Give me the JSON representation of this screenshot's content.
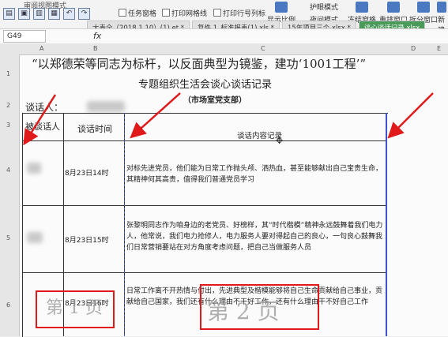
{
  "toolbar": {
    "menu_partial": "审阅视图模式",
    "checkbox_task_pane": "任务窗格",
    "checkbox_print_gridlines": "打印网格线",
    "checkbox_print_row_col": "打印行号列标",
    "btn_show_ratio": "显示比例",
    "btn_eye_protection": "护眼模式",
    "btn_night_mode": "夜间模式",
    "btn_freeze": "冻结窗格",
    "btn_rearrange": "重排窗口",
    "btn_split": "拆分窗口",
    "btn_new": "新建"
  },
  "tabs": [
    {
      "label": "大表全（2018.1.10）(1).et *"
    },
    {
      "label": "复件 1_标准报表(1).xls *"
    },
    {
      "label": "15年项目三个.xlsx *"
    },
    {
      "label": "谈心谈话记录.xlsx"
    }
  ],
  "formula_bar": {
    "cell_ref": "G49",
    "fx": "fx"
  },
  "columns": [
    "A",
    "B",
    "C",
    "D",
    "E"
  ],
  "rows": [
    "1",
    "2",
    "3",
    "4",
    "5",
    "6"
  ],
  "document": {
    "title_line1": "“以郑德荣等同志为标杆，以反面典型为镜鉴，建功‘1001工程’”",
    "title_line2": "专题组织生活会谈心谈话记录",
    "title_line3": "（市场室党支部）",
    "talker_label": "谈话人：",
    "headers": {
      "person": "被谈话人",
      "time": "谈话时间",
      "content": "谈话内容记录"
    },
    "records": [
      {
        "time": "8月23日14时",
        "content": "对标先进党员，他们能为日常工作抛头颅、洒热血，甚至能够献出自己宝贵生命，其精神何其高贵，值得我们普通党员学习"
      },
      {
        "time": "8月23日15时",
        "content": "张黎明同志作为咱身边的老党员、好榜样，其“时代楷模”精神永远鼓舞着我们电力人，他常说，我们电力抢修人，电力服务人要对得起自己的良心，一句良心鼓舞我们日常营销要站在对方角度考虑问题，把自己当做服务人员"
      },
      {
        "time": "8月23日16时",
        "content": "日常工作离不开热情与付出，先进典型及楷模能够将自己生命贡献给自己事业，贡献给自己国家，我们还有什么理由不干好工作，还有什么理由干不好自己工作"
      }
    ],
    "page_labels": {
      "page1": "第 1 页",
      "page2": "第 2 页"
    }
  },
  "accent_colors": {
    "annotation_red": "#e01a1a",
    "page_break_blue": "#3b4fd0"
  }
}
